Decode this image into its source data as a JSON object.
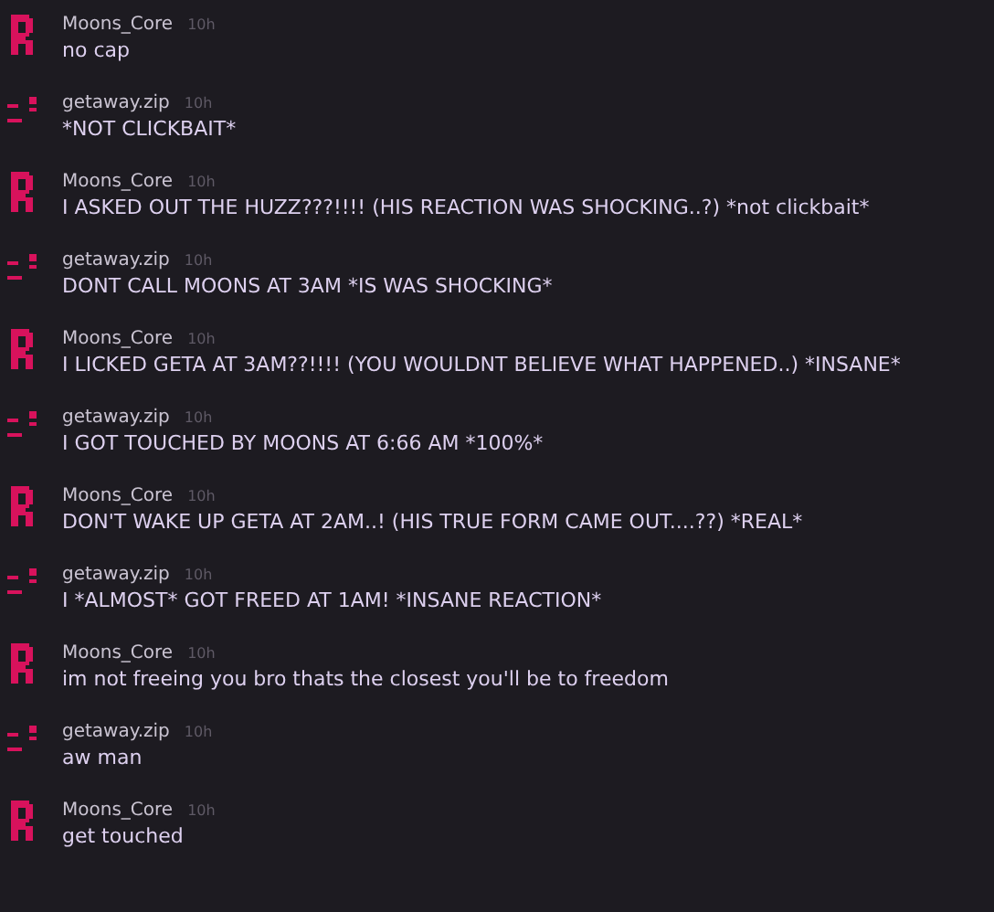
{
  "messages": [
    {
      "author": "Moons_Core",
      "kind": "blocky",
      "time": "10h",
      "text": "no cap"
    },
    {
      "author": "getaway.zip",
      "kind": "face",
      "time": "10h",
      "text": "*NOT CLICKBAIT*"
    },
    {
      "author": "Moons_Core",
      "kind": "blocky",
      "time": "10h",
      "text": "I ASKED OUT THE HUZZ???!!!! (HIS REACTION WAS SHOCKING..?) *not clickbait*"
    },
    {
      "author": "getaway.zip",
      "kind": "face",
      "time": "10h",
      "text": "DONT CALL MOONS AT 3AM *IS WAS SHOCKING*"
    },
    {
      "author": "Moons_Core",
      "kind": "blocky",
      "time": "10h",
      "text": "I LICKED GETA AT 3AM??!!!! (YOU WOULDNT BELIEVE WHAT HAPPENED..) *INSANE*"
    },
    {
      "author": "getaway.zip",
      "kind": "face",
      "time": "10h",
      "text": "I GOT TOUCHED BY MOONS AT 6:66 AM *100%*"
    },
    {
      "author": "Moons_Core",
      "kind": "blocky",
      "time": "10h",
      "text": "DON'T WAKE UP GETA AT 2AM..! (HIS TRUE FORM CAME OUT....??) *REAL*"
    },
    {
      "author": "getaway.zip",
      "kind": "face",
      "time": "10h",
      "text": "I *ALMOST* GOT FREED AT 1AM! *INSANE REACTION*"
    },
    {
      "author": "Moons_Core",
      "kind": "blocky",
      "time": "10h",
      "text": "im not freeing you bro thats the closest you'll be to freedom"
    },
    {
      "author": "getaway.zip",
      "kind": "face",
      "time": "10h",
      "text": "aw man"
    },
    {
      "author": "Moons_Core",
      "kind": "blocky",
      "time": "10h",
      "text": "get touched"
    }
  ]
}
